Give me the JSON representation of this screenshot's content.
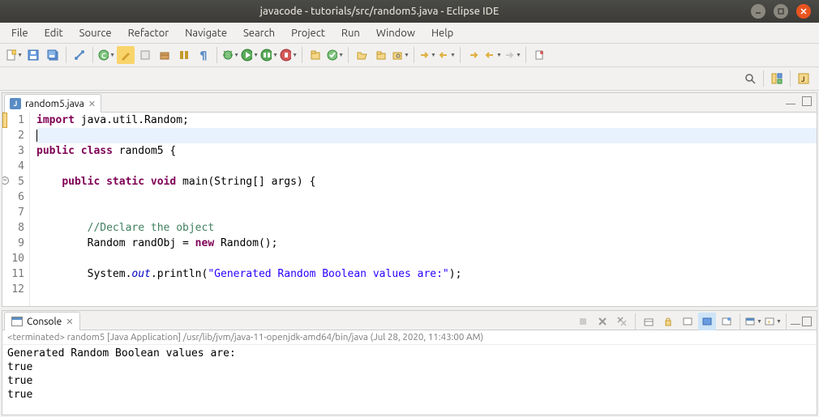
{
  "window": {
    "title": "javacode - tutorials/src/random5.java - Eclipse IDE"
  },
  "menu": [
    "File",
    "Edit",
    "Source",
    "Refactor",
    "Navigate",
    "Search",
    "Project",
    "Run",
    "Window",
    "Help"
  ],
  "editor": {
    "tab_label": "random5.java",
    "tab_close_glyph": "✕"
  },
  "code": {
    "lines": [
      {
        "n": 1,
        "html": "<span class='kw'>import</span> java.util.Random;"
      },
      {
        "n": 2,
        "html": "<span class='cursor-bar'></span>",
        "current": true
      },
      {
        "n": 3,
        "html": "<span class='kw'>public</span> <span class='kw'>class</span> random5 {"
      },
      {
        "n": 4,
        "html": ""
      },
      {
        "n": 5,
        "html": "    <span class='kw'>public</span> <span class='kw'>static</span> <span class='kw'>void</span> main(String[] args) {",
        "fold": true
      },
      {
        "n": 6,
        "html": ""
      },
      {
        "n": 7,
        "html": ""
      },
      {
        "n": 8,
        "html": "        <span class='cmt'>//Declare the object</span>"
      },
      {
        "n": 9,
        "html": "        Random randObj = <span class='kw'>new</span> Random();"
      },
      {
        "n": 10,
        "html": ""
      },
      {
        "n": 11,
        "html": "        System.<span class='fld'>out</span>.println(<span class='str'>\"Generated Random Boolean values are:\"</span>);"
      },
      {
        "n": 12,
        "html": ""
      }
    ]
  },
  "console": {
    "tab_label": "Console",
    "tab_close_glyph": "✕",
    "status_prefix": "<terminated>",
    "status_text": "random5 [Java Application] /usr/lib/jvm/java-11-openjdk-amd64/bin/java (Jul 28, 2020, 11:43:00 AM)",
    "output": "Generated Random Boolean values are:\ntrue\ntrue\ntrue"
  }
}
